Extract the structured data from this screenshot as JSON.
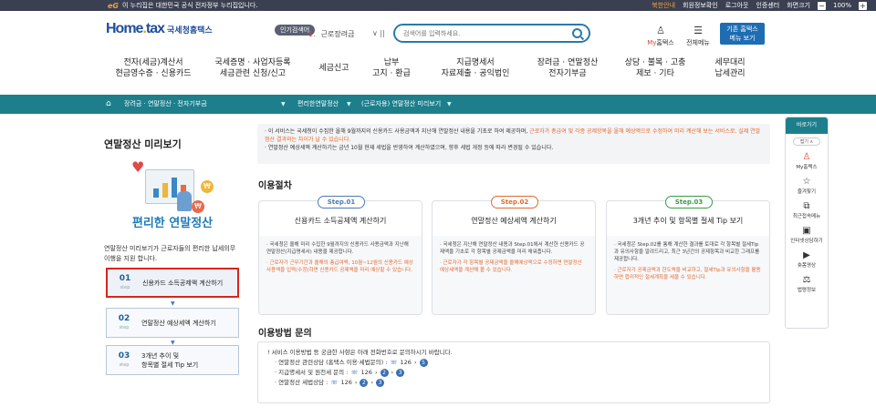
{
  "topbar": {
    "gov_mark": "eG",
    "gov_text": "이 누리집은 대한민국 공식 전자정부 누리집입니다.",
    "links": [
      "회원정보확인",
      "로그아웃",
      "인증센터",
      "화면크기"
    ],
    "lang": "북한안내",
    "zoom_out": "−",
    "zoom_value": "100%",
    "zoom_in": "+"
  },
  "header": {
    "logo_main": "Home",
    "logo_accent": "tax",
    "logo_sub": "국세청홈택스",
    "popular_label": "인기검색어",
    "popular_rank": "1.",
    "popular_term": "근로장려금",
    "popular_controls": "∨ ||",
    "search_placeholder": "검색어를 입력하세요.",
    "myhome_prefix": "My",
    "myhome_suffix": "홈택스",
    "allmenu": "전체메뉴",
    "basic_btn_line1": "기존 홈택스",
    "basic_btn_line2": "메뉴 보기"
  },
  "gnb": [
    {
      "line1": "전자(세금)계산서",
      "line2": "현금영수증 · 신용카드"
    },
    {
      "line1": "국세증명 · 사업자등록",
      "line2": "세금관련 신청/신고"
    },
    {
      "line1": "세금신고",
      "line2": ""
    },
    {
      "line1": "납부",
      "line2": "고지 · 환급"
    },
    {
      "line1": "지급명세서",
      "line2": "자료제출 · 공익법인"
    },
    {
      "line1": "장려금 · 연말정산",
      "line2": "전자기부금"
    },
    {
      "line1": "상담 · 불복 · 고충",
      "line2": "제보 · 기타"
    },
    {
      "line1": "세무대리",
      "line2": "납세관리"
    }
  ],
  "breadcrumb": {
    "home": "⌂",
    "level1": "장려금 · 연말정산 · 전자기부금",
    "level2": "편리한연말정산",
    "level3": "(근로자용) 연말정산 미리보기",
    "dropdown": "▼"
  },
  "left": {
    "title": "연말정산 미리보기",
    "illus_caption": "편리한 연말정산",
    "desc": "연말정산 미리보기가 근로자들의 편리한 납세의무 이행을 지원 합니다.",
    "coin1": "₩",
    "coin2": "₩",
    "heart": "♥",
    "steps": [
      {
        "no": "01",
        "step": "step",
        "label": "신용카드 소득공제액 계산하기",
        "active": true
      },
      {
        "no": "02",
        "step": "step",
        "label": "연말정산 예상세액 계산하기",
        "active": false
      },
      {
        "no": "03",
        "step": "step",
        "label_line1": "3개년 추이 및",
        "label_line2": "항목별 절세 Tip 보기",
        "active": false
      }
    ],
    "arrow": "▼"
  },
  "info": {
    "line1_a": "· 이 서비스는 국세청이 수집한 올해 9월까지의 신용카드 사용금액과 지난해 연말정산 내용을 기초로 하여 제공하며, ",
    "line1_b": "근로자가 총급여 및 각종 공제항목을 올해 예상액으로 수정하여 미리 계산해 보는 서비스로, 실제 연말정산 결과와는 차이가 날 수 있습니다.",
    "line2": "· 연말정산 예상세액 계산하기는 금년 10월 현재 세법을 반영하여 계산하였으며, 향후 세법 개정 등에 따라 변경될 수 있습니다."
  },
  "procedure": {
    "title": "이용절차",
    "cards": [
      {
        "pill": "Step.01",
        "pill_color": "#4e78b8",
        "title": "신용카드 소득공제액 계산하기",
        "body": "· 국세청은 올해 미리 수집한 9월까지의 신용카드 사용금액과 지난해 연말정산(지급명세서) 내용을 제공합니다.",
        "note": "· 근로자가 근무기간과 올해의 총급여액, 10월~12월의 신용카드 예상 사용액을 입력(수정)하면 신용카드 공제액을 미리 예상할 수 있습니다."
      },
      {
        "pill": "Step.02",
        "pill_color": "#e26a2e",
        "title": "연말정산 예상세액 계산하기",
        "body": "· 국세청은 지난해 연말정산 내용과 Step.01에서 계산한 신용카드 공제액을 기초로 각 항목별 공제금액을 미리 채워줍니다.",
        "note": "· 근로자가 각 항목별 공제금액을 올해예상액으로 수정하면 연말정산 예상세액을 계산해 볼 수 있습니다."
      },
      {
        "pill": "Step.03",
        "pill_color": "#3a9a4a",
        "title": "3개년 추이 및 항목별 절세 Tip 보기",
        "body": "· 국세청은 Step.02를 통해 계산한 결과를 토대로 각 항목별 절세Tip과 유의사항을 알려드리고, 최근 3년간의 공제항목과 비교한 그래프를 제공합니다.",
        "note": "· 근로자가 공제금액과 한도액을 비교하고, 절세Tip과 유의사항을 활용하면 합리적인 절세계획을 세울 수 있습니다."
      }
    ]
  },
  "inquiry": {
    "title": "이용방법 문의",
    "intro": "! 서비스 이용방법 등 궁금한 사항은 아래 전화번호로 문의하시기 바랍니다.",
    "rows": [
      {
        "label": "· 연말정산 관련상담 (홈택스 이용·세법문의) :",
        "phone": "126",
        "b1": "5",
        "b2": ""
      },
      {
        "label": "· 지급명세서 및 원천세 문의 :",
        "phone": "126",
        "b1": "2",
        "b2": "3"
      },
      {
        "label": "· 연말정산 세법상담 :",
        "phone": "126",
        "b1": "2",
        "b2": "3"
      }
    ],
    "phone_icon": "☏",
    "arrow": "›"
  },
  "rightnav": {
    "header": "바로가기",
    "fold": "접기 ∧",
    "items": [
      {
        "icon": "♙",
        "label": "My홈택스"
      },
      {
        "icon": "☆",
        "label": "즐겨찾기"
      },
      {
        "icon": "⧉",
        "label": "최근접속메뉴"
      },
      {
        "icon": "▣",
        "label": "인터넷상담하기"
      },
      {
        "icon": "▶",
        "label": "숏폼영상"
      },
      {
        "icon": "⚖",
        "label": "법령정보"
      }
    ]
  }
}
